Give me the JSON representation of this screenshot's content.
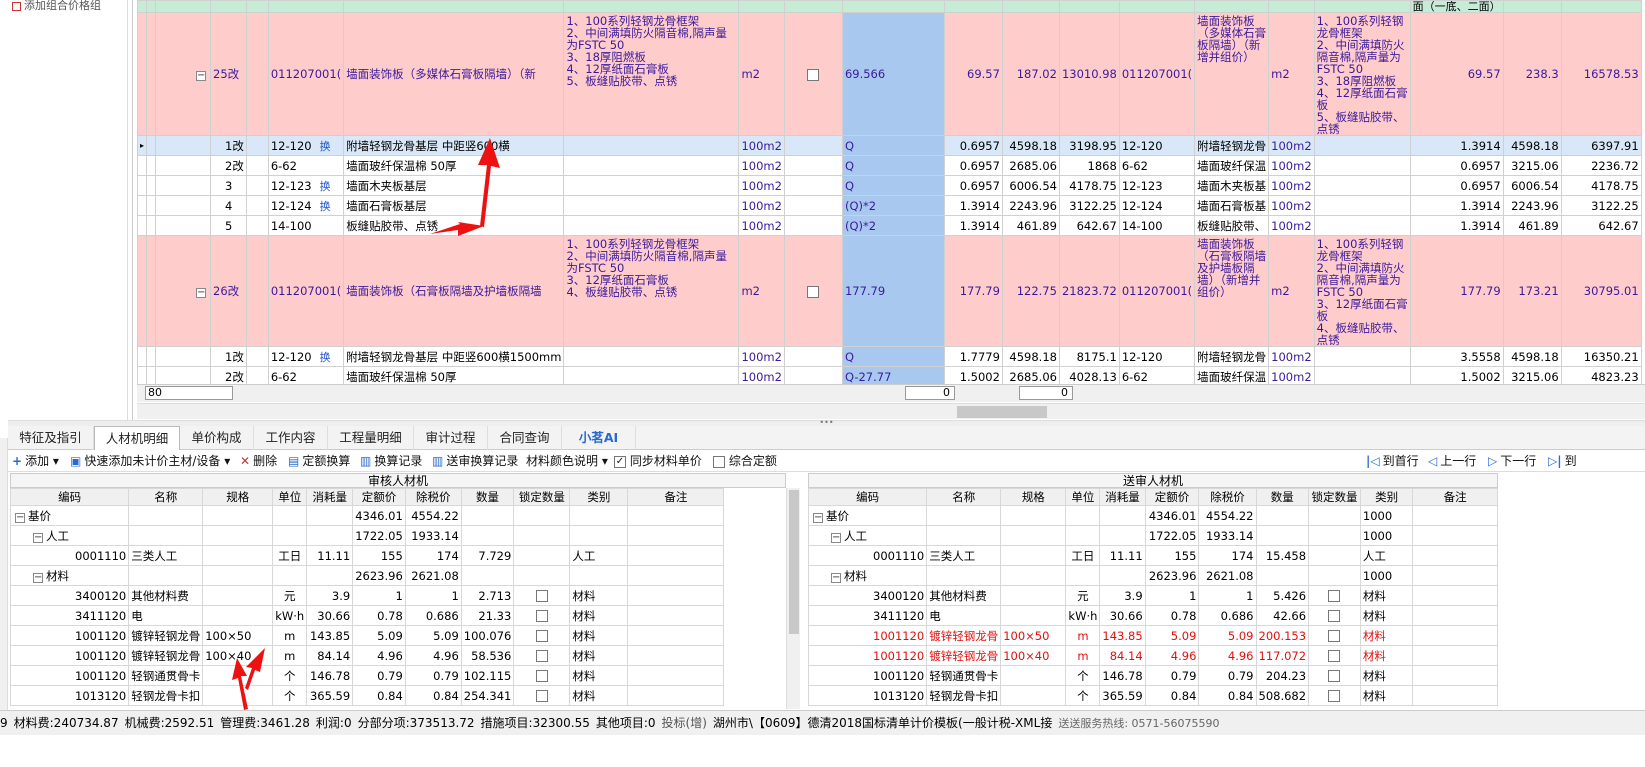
{
  "left_tree": {
    "top_item": "添加组合价格组"
  },
  "grid": {
    "header_right": "面（一底、二面）",
    "bottom_input": "80",
    "bottom_zero_1": "0",
    "bottom_zero_2": "0",
    "group1": {
      "seq": "25改",
      "code": "011207001(",
      "name": "墙面装饰板（多媒体石膏板隔墙）（新",
      "desc": "1、100系列轻钢龙骨框架\n2、中间满填防火隔音棉,隔声量为FSTC 50\n3、18厚阻燃板\n4、12厚纸面石膏板\n5、板缝贴胶带、点锈",
      "unit": "m2",
      "qty_expr": "69.566",
      "qty": "69.57",
      "price": "187.02",
      "total": "13010.98",
      "s_code": "011207001(",
      "s_name": "墙面装饰板（多媒体石膏板隔墙）（新增并组价）",
      "s_unit": "m2",
      "s_desc": "1、100系列轻钢龙骨框架\n2、中间满填防火隔音棉,隔声量为FSTC 50\n3、18厚阻燃板\n4、12厚纸面石膏板\n5、板缝贴胶带、点锈",
      "s_qty": "69.57",
      "s_price": "238.3",
      "s_total": "16578.53",
      "items": [
        {
          "seq": "1改",
          "code": "12-120",
          "huan": "换",
          "name": "附墙轻钢龙骨基层 中距竖600横",
          "unit": "100m2",
          "expr": "Q",
          "qty": "0.6957",
          "price": "4598.18",
          "total": "3198.95",
          "s_code": "12-120",
          "s_name": "附墙轻钢龙骨",
          "s_unit": "100m2",
          "s_qty": "1.3914",
          "s_price": "4598.18",
          "s_total": "6397.91",
          "sel": true
        },
        {
          "seq": "2改",
          "code": "6-62",
          "huan": "",
          "name": "墙面玻纤保温棉 50厚",
          "unit": "100m2",
          "expr": "Q",
          "qty": "0.6957",
          "price": "2685.06",
          "total": "1868",
          "s_code": "6-62",
          "s_name": "墙面玻纤保温",
          "s_unit": "100m2",
          "s_qty": "0.6957",
          "s_price": "3215.06",
          "s_total": "2236.72"
        },
        {
          "seq": "3",
          "code": "12-123",
          "huan": "换",
          "name": "墙面木夹板基层",
          "unit": "100m2",
          "expr": "Q",
          "qty": "0.6957",
          "price": "6006.54",
          "total": "4178.75",
          "s_code": "12-123",
          "s_name": "墙面木夹板基",
          "s_unit": "100m2",
          "s_qty": "0.6957",
          "s_price": "6006.54",
          "s_total": "4178.75"
        },
        {
          "seq": "4",
          "code": "12-124",
          "huan": "换",
          "name": "墙面石膏板基层",
          "unit": "100m2",
          "expr": "(Q)*2",
          "qty": "1.3914",
          "price": "2243.96",
          "total": "3122.25",
          "s_code": "12-124",
          "s_name": "墙面石膏板基",
          "s_unit": "100m2",
          "s_qty": "1.3914",
          "s_price": "2243.96",
          "s_total": "3122.25"
        },
        {
          "seq": "5",
          "code": "14-100",
          "huan": "",
          "name": "板缝贴胶带、点锈",
          "unit": "100m2",
          "expr": "(Q)*2",
          "qty": "1.3914",
          "price": "461.89",
          "total": "642.67",
          "s_code": "14-100",
          "s_name": "板缝贴胶带、",
          "s_unit": "100m2",
          "s_qty": "1.3914",
          "s_price": "461.89",
          "s_total": "642.67"
        }
      ]
    },
    "group2": {
      "seq": "26改",
      "code": "011207001(",
      "name": "墙面装饰板（石膏板隔墙及护墙板隔墙",
      "desc": "1、100系列轻钢龙骨框架\n2、中间满填防火隔音棉,隔声量为FSTC 50\n3、12厚纸面石膏板\n4、板缝贴胶带、点锈",
      "unit": "m2",
      "qty_expr": "177.79",
      "qty": "177.79",
      "price": "122.75",
      "total": "21823.72",
      "s_code": "011207001(",
      "s_name": "墙面装饰板（石膏板隔墙及护墙板隔墙）（新增并组价）",
      "s_unit": "m2",
      "s_desc": "1、100系列轻钢龙骨框架\n2、中间满填防火隔音棉,隔声量为FSTC 50\n3、12厚纸面石膏板\n4、板缝贴胶带、点锈",
      "s_qty": "177.79",
      "s_price": "173.21",
      "s_total": "30795.01",
      "items": [
        {
          "seq": "1改",
          "code": "12-120",
          "huan": "换",
          "name": "附墙轻钢龙骨基层 中距竖600横1500mm",
          "unit": "100m2",
          "expr": "Q",
          "qty": "1.7779",
          "price": "4598.18",
          "total": "8175.1",
          "s_code": "12-120",
          "s_name": "附墙轻钢龙骨",
          "s_unit": "100m2",
          "s_qty": "3.5558",
          "s_price": "4598.18",
          "s_total": "16350.21"
        },
        {
          "seq": "2改",
          "code": "6-62",
          "huan": "",
          "name": "墙面玻纤保温棉 50厚",
          "unit": "100m2",
          "expr": "Q-27.77",
          "qty": "1.5002",
          "price": "2685.06",
          "total": "4028.13",
          "s_code": "6-62",
          "s_name": "墙面玻纤保温",
          "s_unit": "100m2",
          "s_qty": "1.5002",
          "s_price": "3215.06",
          "s_total": "4823.23"
        }
      ]
    }
  },
  "tabs": [
    "特征及指引",
    "人材机明细",
    "单价构成",
    "工作内容",
    "工程量明细",
    "审计过程",
    "合同查询",
    "小茗AI"
  ],
  "toolbar": {
    "add": "添加",
    "quick_add": "快速添加未计价主材/设备",
    "delete": "删除",
    "quota_conv": "定额换算",
    "conv_record": "换算记录",
    "sent_conv_record": "送审换算记录",
    "mat_color": "材料颜色说明",
    "sync_price": "同步材料单价",
    "comprehensive": "综合定额",
    "first": "到首行",
    "prev": "上一行",
    "next": "下一行",
    "last": "到"
  },
  "audit_table": {
    "title": "审核人材机",
    "headers": [
      "编码",
      "名称",
      "规格",
      "单位",
      "消耗量",
      "定额价",
      "除税价",
      "数量",
      "锁定数量",
      "类别",
      "备注"
    ],
    "rows": [
      {
        "lvl": 0,
        "tog": "−",
        "code": "基价",
        "name": "",
        "spec": "",
        "unit": "",
        "cons": "",
        "quota": "4346.01",
        "notax": "4554.22",
        "qty": "",
        "lock": false,
        "type": ""
      },
      {
        "lvl": 1,
        "tog": "−",
        "code": "人工",
        "name": "",
        "spec": "",
        "unit": "",
        "cons": "",
        "quota": "1722.05",
        "notax": "1933.14",
        "qty": "",
        "lock": false,
        "type": ""
      },
      {
        "lvl": 2,
        "code": "0001110",
        "name": "三类人工",
        "spec": "",
        "unit": "工日",
        "cons": "11.11",
        "quota": "155",
        "notax": "174",
        "qty": "7.729",
        "lock": false,
        "type": "人工"
      },
      {
        "lvl": 1,
        "tog": "−",
        "code": "材料",
        "name": "",
        "spec": "",
        "unit": "",
        "cons": "",
        "quota": "2623.96",
        "notax": "2621.08",
        "qty": "",
        "lock": false,
        "type": ""
      },
      {
        "lvl": 2,
        "code": "3400120",
        "name": "其他材料费",
        "spec": "",
        "unit": "元",
        "cons": "3.9",
        "quota": "1",
        "notax": "1",
        "qty": "2.713",
        "lock": true,
        "type": "材料"
      },
      {
        "lvl": 2,
        "code": "3411120",
        "name": "电",
        "spec": "",
        "unit": "kW·h",
        "cons": "30.66",
        "quota": "0.78",
        "notax": "0.686",
        "qty": "21.33",
        "lock": true,
        "type": "材料"
      },
      {
        "lvl": 2,
        "code": "1001120",
        "name": "镀锌轻钢龙骨",
        "spec": "100×50",
        "unit": "m",
        "cons": "143.85",
        "quota": "5.09",
        "notax": "5.09",
        "qty": "100.076",
        "lock": true,
        "type": "材料"
      },
      {
        "lvl": 2,
        "code": "1001120",
        "name": "镀锌轻钢龙骨",
        "spec": "100×40",
        "unit": "m",
        "cons": "84.14",
        "quota": "4.96",
        "notax": "4.96",
        "qty": "58.536",
        "lock": true,
        "type": "材料"
      },
      {
        "lvl": 2,
        "code": "1001120",
        "name": "轻钢通贯骨卡",
        "spec": "",
        "unit": "个",
        "cons": "146.78",
        "quota": "0.79",
        "notax": "0.79",
        "qty": "102.115",
        "lock": true,
        "type": "材料"
      },
      {
        "lvl": 2,
        "code": "1013120",
        "name": "轻钢龙骨卡扣",
        "spec": "",
        "unit": "个",
        "cons": "365.59",
        "quota": "0.84",
        "notax": "0.84",
        "qty": "254.341",
        "lock": true,
        "type": "材料"
      }
    ]
  },
  "sent_table": {
    "title": "送审人材机",
    "headers": [
      "编码",
      "名称",
      "规格",
      "单位",
      "消耗量",
      "定额价",
      "除税价",
      "数量",
      "锁定数量",
      "类别",
      "备注"
    ],
    "rows": [
      {
        "lvl": 0,
        "tog": "−",
        "code": "基价",
        "name": "",
        "spec": "",
        "unit": "",
        "cons": "",
        "quota": "4346.01",
        "notax": "4554.22",
        "qty": "",
        "lock": false,
        "type": "1000"
      },
      {
        "lvl": 1,
        "tog": "−",
        "code": "人工",
        "name": "",
        "spec": "",
        "unit": "",
        "cons": "",
        "quota": "1722.05",
        "notax": "1933.14",
        "qty": "",
        "lock": false,
        "type": "1000"
      },
      {
        "lvl": 2,
        "code": "0001110",
        "name": "三类人工",
        "spec": "",
        "unit": "工日",
        "cons": "11.11",
        "quota": "155",
        "notax": "174",
        "qty": "15.458",
        "lock": false,
        "type": "人工"
      },
      {
        "lvl": 1,
        "tog": "−",
        "code": "材料",
        "name": "",
        "spec": "",
        "unit": "",
        "cons": "",
        "quota": "2623.96",
        "notax": "2621.08",
        "qty": "",
        "lock": false,
        "type": "1000"
      },
      {
        "lvl": 2,
        "code": "3400120",
        "name": "其他材料费",
        "spec": "",
        "unit": "元",
        "cons": "3.9",
        "quota": "1",
        "notax": "1",
        "qty": "5.426",
        "lock": true,
        "type": "材料"
      },
      {
        "lvl": 2,
        "code": "3411120",
        "name": "电",
        "spec": "",
        "unit": "kW·h",
        "cons": "30.66",
        "quota": "0.78",
        "notax": "0.686",
        "qty": "42.66",
        "lock": true,
        "type": "材料"
      },
      {
        "lvl": 2,
        "red": true,
        "code": "1001120",
        "name": "镀锌轻钢龙骨",
        "spec": "100×50",
        "unit": "m",
        "cons": "143.85",
        "quota": "5.09",
        "notax": "5.09",
        "qty": "200.153",
        "lock": true,
        "type": "材料"
      },
      {
        "lvl": 2,
        "red": true,
        "code": "1001120",
        "name": "镀锌轻钢龙骨",
        "spec": "100×40",
        "unit": "m",
        "cons": "84.14",
        "quota": "4.96",
        "notax": "4.96",
        "qty": "117.072",
        "lock": true,
        "type": "材料"
      },
      {
        "lvl": 2,
        "code": "1001120",
        "name": "轻钢通贯骨卡",
        "spec": "",
        "unit": "个",
        "cons": "146.78",
        "quota": "0.79",
        "notax": "0.79",
        "qty": "204.23",
        "lock": true,
        "type": "材料"
      },
      {
        "lvl": 2,
        "code": "1013120",
        "name": "轻钢龙骨卡扣",
        "spec": "",
        "unit": "个",
        "cons": "365.59",
        "quota": "0.84",
        "notax": "0.84",
        "qty": "508.682",
        "lock": true,
        "type": "材料"
      }
    ]
  },
  "status": {
    "lead": "9",
    "material": "材料费:240734.87",
    "machine": "机械费:2592.51",
    "mgmt": "管理费:3461.28",
    "profit": "利润:0",
    "part": "分部分项:373513.72",
    "measure": "措施项目:32300.55",
    "other": "其他项目:0",
    "bid": "投标(增)",
    "template": "湖州市\\【0609】德清2018国标清单计价模板(一般计税-XML接",
    "hotline": "送送服务热线: 0571-56075590"
  },
  "colors": {
    "pink_row": "#ffcccc",
    "blue_col": "#a8c8f0",
    "header_green": "#c6ecd6",
    "red_text": "#e01010",
    "arrow_red": "#ee1111"
  }
}
